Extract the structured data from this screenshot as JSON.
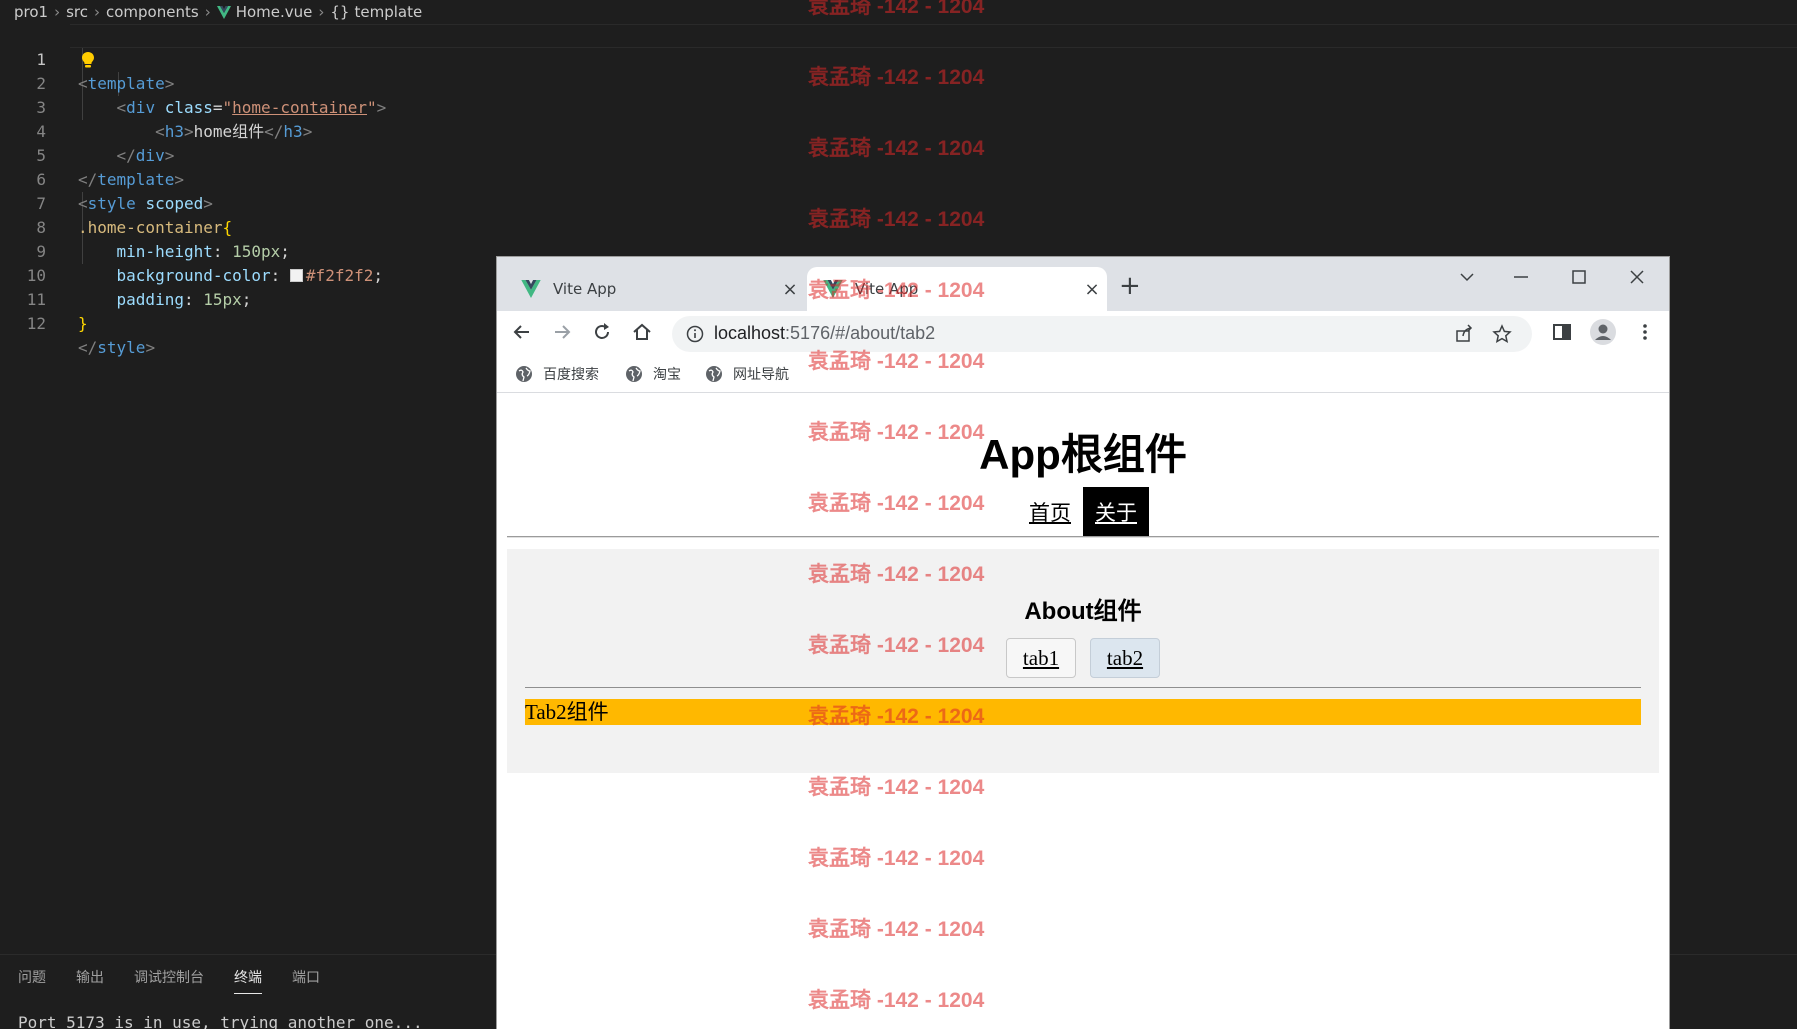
{
  "breadcrumb": [
    "pro1",
    "src",
    "components",
    "Home.vue",
    "template"
  ],
  "editor": {
    "line_numbers": [
      "1",
      "2",
      "3",
      "4",
      "5",
      "6",
      "7",
      "8",
      "9",
      "10",
      "11",
      "12"
    ],
    "code": {
      "l1_open": "<",
      "l1_tag": "template",
      "l1_close": ">",
      "l2_indent": "    ",
      "l2_open": "<",
      "l2_tag": "div",
      "l2_attr": " class",
      "l2_eq": "=",
      "l2_q1": "\"",
      "l2_val": "home-container",
      "l2_q2": "\"",
      "l2_close": ">",
      "l3_indent": "        ",
      "l3_open": "<",
      "l3_tag": "h3",
      "l3_close": ">",
      "l3_text": "home组件",
      "l3_eopen": "</",
      "l3_etag": "h3",
      "l3_eclose": ">",
      "l4_indent": "    ",
      "l4_open": "</",
      "l4_tag": "div",
      "l4_close": ">",
      "l5_open": "</",
      "l5_tag": "template",
      "l5_close": ">",
      "l6_open": "<",
      "l6_tag": "style",
      "l6_attr": " scoped",
      "l6_close": ">",
      "l7_sel": ".home-container",
      "l7_brace": "{",
      "l8_indent": "    ",
      "l8_prop": "min-height",
      "l8_colon": ": ",
      "l8_val": "150px",
      "l8_semi": ";",
      "l9_indent": "    ",
      "l9_prop": "background-color",
      "l9_colon": ": ",
      "l9_val": "#f2f2f2",
      "l9_semi": ";",
      "l10_indent": "    ",
      "l10_prop": "padding",
      "l10_colon": ": ",
      "l10_val": "15px",
      "l10_semi": ";",
      "l11_brace": "}",
      "l12_open": "</",
      "l12_tag": "style",
      "l12_close": ">"
    }
  },
  "panel": {
    "tabs": [
      "问题",
      "输出",
      "调试控制台",
      "终端",
      "端口"
    ],
    "active_tab": "终端",
    "terminal_text": "Port 5173 is in use, trying another one..."
  },
  "browser": {
    "tabs": [
      {
        "title": "Vite App",
        "close": "×"
      },
      {
        "title": "Vite App",
        "close": "×"
      }
    ],
    "new_tab": "+",
    "url_host": "localhost",
    "url_path": ":5176/#/about/tab2",
    "bookmarks": [
      "百度搜索",
      "淘宝",
      "网址导航"
    ]
  },
  "page": {
    "app_title": "App根组件",
    "nav": [
      "首页",
      "关于"
    ],
    "about_title": "About组件",
    "about_tabs": [
      "tab1",
      "tab2"
    ],
    "tab2_text": "Tab2组件"
  },
  "watermark": "袁孟琦 -142 - 1204",
  "colors": {
    "editor_bg": "#1e1e1e",
    "tab2_bg": "#ffb800",
    "about_bg": "#f2f2f2",
    "watermark": "#dc2828"
  }
}
